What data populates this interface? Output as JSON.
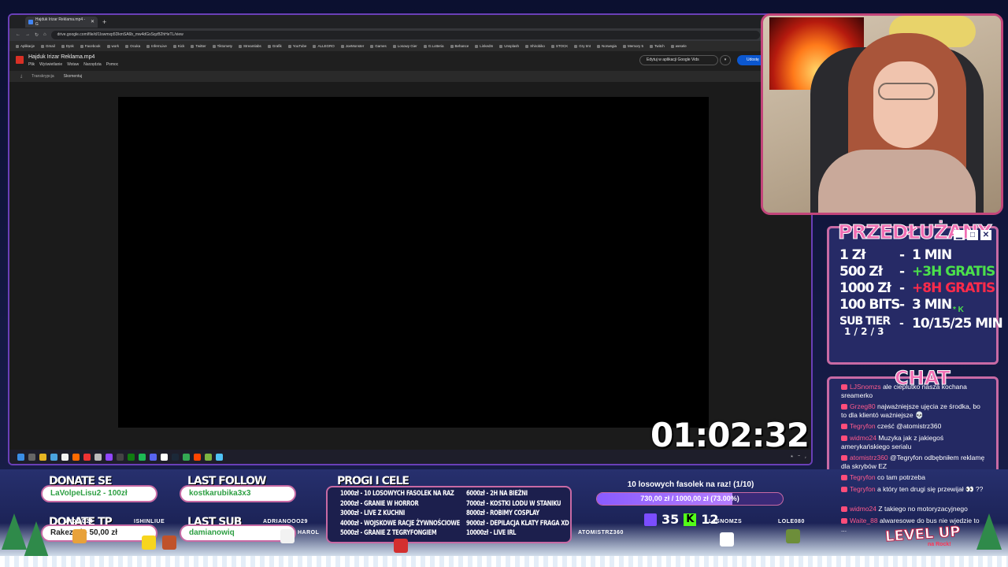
{
  "browser": {
    "tab_title": "Hajduk Irizar Reklama.mp4 - G",
    "new_tab": "+",
    "url": "drive.google.com/file/d/1Iswmxp5DkmSA6b_mw4dGsSqzB2hHeTL/view",
    "bookmarks": [
      "Aplikacje",
      "Gmail",
      "Dysk",
      "Facebook",
      "work",
      "Ocuka",
      "InfernLive",
      "Kick",
      "Twitter",
      "Tiktomety",
      "Streamlabs",
      "Grafik",
      "YouTube",
      "ALLEGRO",
      "JoeMonster",
      "Games",
      "Losowy Gier",
      "G.Lotteria",
      "Behance",
      "LinkedIn",
      "Unsplash",
      "Shirobiko",
      "STOCK",
      "Gry tmt",
      "Norwegia",
      "Memory 5",
      "Twitch",
      "wesele"
    ]
  },
  "drive": {
    "file_title": "Hajduk Irizar Reklama.mp4",
    "menu": [
      "Plik",
      "Wyświetlanie",
      "Wstaw",
      "Narzędzia",
      "Pomoc"
    ],
    "open_with": "Edytuj w aplikacji Google Vids",
    "share": "Udostę",
    "toolbar": [
      "Transkrypcja",
      "Skomentuj"
    ]
  },
  "timer": "01:02:32",
  "extension": {
    "title": "PRZEDŁUŻANY",
    "rates": [
      {
        "amount": "1 Zł",
        "value": "1 MIN",
        "color": "white"
      },
      {
        "amount": "500 Zł",
        "value": "+3H GRATIS",
        "color": "green"
      },
      {
        "amount": "1000 Zł",
        "value": "+8H GRATIS",
        "color": "red"
      },
      {
        "amount": "100 BITS",
        "value": "3 MIN",
        "color": "white"
      },
      {
        "amount": "SUB TIER",
        "value": "10/15/25 MIN",
        "color": "white"
      }
    ],
    "tier_sub": "1 / 2 / 3",
    "tier_k": "* K",
    "controls": [
      "▁",
      "□",
      "✕"
    ]
  },
  "chat": {
    "title": "CHAT",
    "messages": [
      {
        "nick": "LJSnomzs",
        "text": "ale cieplutko nasza kochana sreamerko"
      },
      {
        "nick": "Grzeg80",
        "text": "najważniejsze ujęcia ze środka, bo to dla klientó ważniejsze 💀"
      },
      {
        "nick": "Tegryfon",
        "text": "cześć @atomistrz360"
      },
      {
        "nick": "widmo24",
        "text": "Muzyka jak z jakiegoś amerykańskiego serialu"
      },
      {
        "nick": "atomistrz360",
        "text": "@Tegryfon odbębniłem reklamę dla skrybów EZ"
      },
      {
        "nick": "Tegryfon",
        "text": "co tam potrzeba"
      },
      {
        "nick": "Tegryfon",
        "text": "a który ten drugi się przewijał 👀 ??"
      },
      {
        "nick": "widmo24",
        "text": "Z takiego no motoryzacyjnego"
      },
      {
        "nick": "Waite_88",
        "text": "alwaresowe do bus nie wjedzie to ..."
      }
    ]
  },
  "bottom": {
    "donate_se_label": "DONATE SE",
    "donate_se_value": "LaVolpeLisu2 - 100zł",
    "donate_tp_label": "DONATE TP",
    "donate_tp_value": "Rakez4d - 50,00 zł",
    "last_follow_label": "LAST FOLLOW",
    "last_follow_value": "kostkarubika3x3",
    "last_sub_label": "LAST SUB",
    "last_sub_value": "damianowiq",
    "goals_title": "PROGI I CELE",
    "goals_left": [
      "1000zł - 10 LOSOWYCH FASOLEK NA RAZ",
      "2000zł - GRANIE W HORROR",
      "3000zł - LIVE Z KUCHNI",
      "4000zł - WOJSKOWE RACJE ŻYWNOŚCIOWE",
      "5000zł - GRANIE Z TEGRYFONGIEM"
    ],
    "goals_right": [
      "6000zł - 2H NA BIEŻNI",
      "7000zł - KOSTKI LODU W STANIKU",
      "8000zł - ROBIMY COSPLAY",
      "9000zł - DEPILACJA KLATY FRAGA XD",
      "10000zł - LIVE IRL"
    ],
    "fasolki_title": "10 losowych fasolek na raz! (1/10)",
    "fasolki_progress": "730,00 zł / 1000,00 zł (73.00%)",
    "fasolki_fraction": 0.73,
    "twitch_viewers": "35",
    "kick_viewers": "12",
    "names": [
      "WIDMO24",
      "ISHINLIUE",
      "ADRIANOOO29",
      "HAROL",
      "ATOMISTRZ360",
      "LJSNOMZS",
      "LOLE080"
    ],
    "levelup": "LEVEL UP",
    "levelup_sub": "na Rock!"
  }
}
